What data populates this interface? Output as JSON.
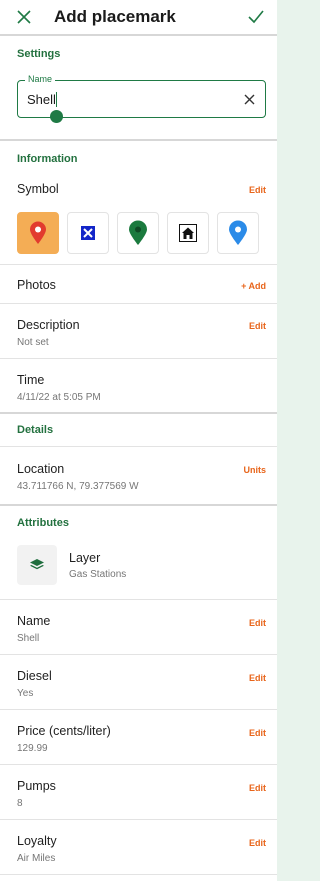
{
  "header": {
    "title": "Add placemark"
  },
  "settings": {
    "heading": "Settings",
    "name_field": {
      "label": "Name",
      "value": "Shell"
    }
  },
  "information": {
    "heading": "Information",
    "symbol": {
      "label": "Symbol",
      "action": "Edit"
    },
    "symbols": [
      {
        "icon": "red-pin-icon",
        "selected": true
      },
      {
        "icon": "blue-x-icon",
        "selected": false
      },
      {
        "icon": "green-pin-icon",
        "selected": false
      },
      {
        "icon": "house-icon",
        "selected": false
      },
      {
        "icon": "blue-pin-icon",
        "selected": false
      }
    ],
    "photos": {
      "label": "Photos",
      "action": "+ Add"
    },
    "description": {
      "label": "Description",
      "value": "Not set",
      "action": "Edit"
    },
    "time": {
      "label": "Time",
      "value": "4/11/22 at 5:05 PM"
    }
  },
  "details": {
    "heading": "Details",
    "location": {
      "label": "Location",
      "value": "43.711766 N, 79.377569 W",
      "action": "Units"
    }
  },
  "attributes": {
    "heading": "Attributes",
    "layer": {
      "label": "Layer",
      "value": "Gas Stations"
    },
    "items": [
      {
        "label": "Name",
        "value": "Shell",
        "action": "Edit"
      },
      {
        "label": "Diesel",
        "value": "Yes",
        "action": "Edit"
      },
      {
        "label": "Price (cents/liter)",
        "value": "129.99",
        "action": "Edit"
      },
      {
        "label": "Pumps",
        "value": "8",
        "action": "Edit"
      },
      {
        "label": "Loyalty",
        "value": "Air Miles",
        "action": "Edit"
      }
    ]
  },
  "colors": {
    "accent_green": "#1f7a45",
    "action_orange": "#e8651b",
    "selected_symbol": "#f4ad55"
  }
}
